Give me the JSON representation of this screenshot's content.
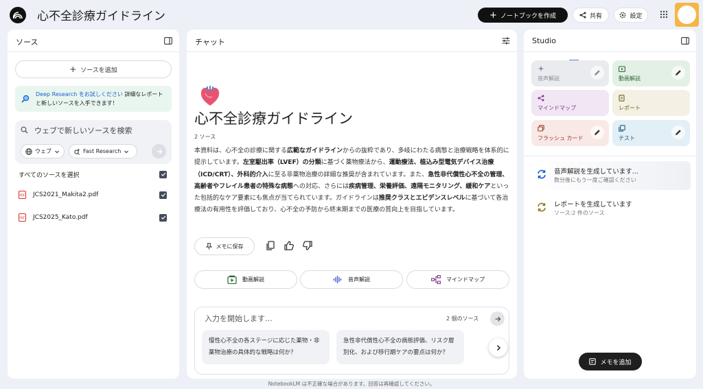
{
  "header": {
    "title": "心不全診療ガイドライン",
    "create_label": "ノートブックを作成",
    "share_label": "共有",
    "settings_label": "設定"
  },
  "sources": {
    "title": "ソース",
    "add_label": "ソースを追加",
    "deep_research_link": "Deep Research をお試しください",
    "deep_research_text": "詳細なレポートと新しいソースを入手できます！",
    "search_placeholder": "ウェブで新しいソースを検索",
    "web_label": "ウェブ",
    "fast_label": "Fast Research",
    "select_all_label": "すべてのソースを選択",
    "files": [
      {
        "name": "JCS2021_Makita2.pdf"
      },
      {
        "name": "JCS2025_Kato.pdf"
      }
    ]
  },
  "chat": {
    "title": "チャット",
    "notebook_title": "心不全診療ガイドライン",
    "source_count": "2 ソース",
    "summary_parts": [
      {
        "t": "本資料は、心不全の診療に関する",
        "b": false
      },
      {
        "t": "広範なガイドライン",
        "b": true
      },
      {
        "t": "からの抜粋であり、多岐にわたる病態と治療戦略を体系的に提示しています。",
        "b": false
      },
      {
        "t": "左室駆出率（LVEF）の分類",
        "b": true
      },
      {
        "t": "に基づく薬物療法から、",
        "b": false
      },
      {
        "t": "運動療法、植込み型電気デバイス治療（ICD/CRT）、外科的介入",
        "b": true
      },
      {
        "t": "に至る非薬物治療の詳細な推奨が含まれています。また、",
        "b": false
      },
      {
        "t": "急性非代償性心不全の管理、高齢者やフレイル患者の特殊な病態",
        "b": true
      },
      {
        "t": "への対応、さらには",
        "b": false
      },
      {
        "t": "疾病管理、栄養評価、遠隔モニタリング、緩和ケア",
        "b": true
      },
      {
        "t": "といった包括的なケア要素にも焦点が当てられています。ガイドラインは",
        "b": false
      },
      {
        "t": "推奨クラスとエビデンスレベル",
        "b": true
      },
      {
        "t": "に基づいて各治療法の有用性を評価しており、心不全の予防から終末期までの医療の質向上を目指しています。",
        "b": false
      }
    ],
    "save_memo_label": "メモに保存",
    "gen_buttons": {
      "video": "動画解説",
      "audio": "音声解説",
      "mindmap": "マインドマップ"
    },
    "input_placeholder": "入力を開始します...",
    "input_sources": "2 個のソース",
    "suggestions": [
      "慢性心不全の各ステージに応じた薬物・非薬物治療の具体的な戦略は何か？",
      "急性非代償性心不全の病態評価、リスク層別化、および移行期ケアの要点は何か？"
    ],
    "footnote": "NotebookLM は不正確な場合があります。回答は再確認してください。"
  },
  "studio": {
    "title": "Studio",
    "tiles": [
      {
        "label": "音声解説",
        "bg": "#e9ebef",
        "fg": "#8a8d93"
      },
      {
        "label": "動画解説",
        "bg": "#e3f0e6",
        "fg": "#2f6b3a"
      },
      {
        "label": "マインドマップ",
        "bg": "#f1e6f4",
        "fg": "#7a3587"
      },
      {
        "label": "レポート",
        "bg": "#f4f1e4",
        "fg": "#6b5d22"
      },
      {
        "label": "フラッシュ カード",
        "bg": "#f8e9e6",
        "fg": "#9a3a28"
      },
      {
        "label": "テスト",
        "bg": "#e2eff7",
        "fg": "#1f5a7d"
      }
    ],
    "generating": [
      {
        "title": "音声解説を生成しています...",
        "sub": "数分後にもう一度ご確認ください"
      },
      {
        "title": "レポートを生成しています",
        "sub": "ソース:2 件のソース"
      }
    ],
    "add_note_label": "メモを追加"
  },
  "colors": {
    "accent": "#1a5fd0",
    "dark": "#1f1f1f",
    "page_bg": "#eef0f8"
  }
}
